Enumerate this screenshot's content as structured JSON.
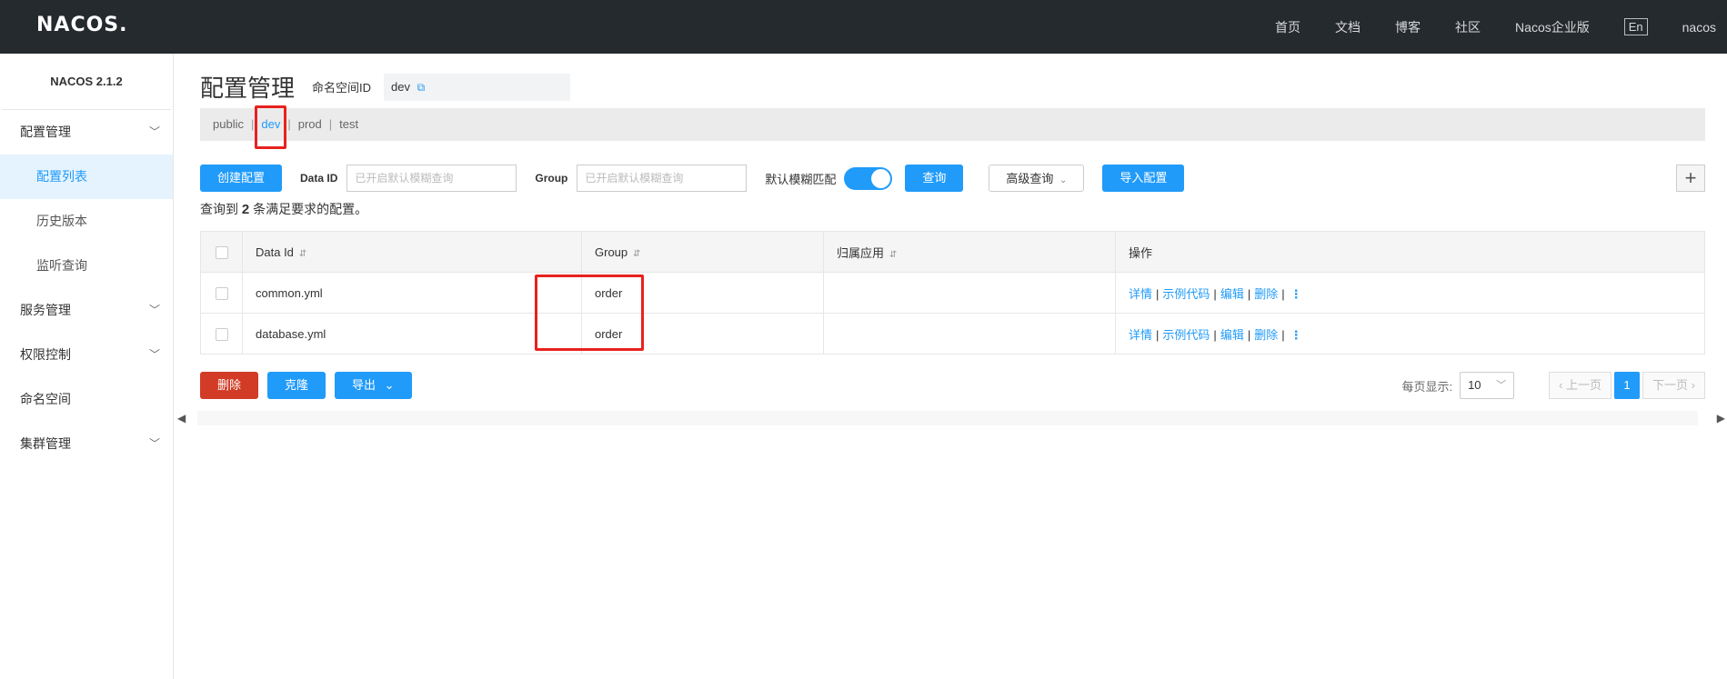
{
  "header": {
    "logo": "NACOS.",
    "nav": [
      "首页",
      "文档",
      "博客",
      "社区",
      "Nacos企业版"
    ],
    "lang": "En",
    "user": "nacos"
  },
  "sidebar": {
    "version": "NACOS 2.1.2",
    "groups": [
      {
        "label": "配置管理",
        "has_chevron": true
      },
      {
        "label": "服务管理",
        "has_chevron": true
      },
      {
        "label": "权限控制",
        "has_chevron": true
      },
      {
        "label": "命名空间",
        "has_chevron": false
      },
      {
        "label": "集群管理",
        "has_chevron": true
      }
    ],
    "config_items": [
      {
        "label": "配置列表",
        "active": true
      },
      {
        "label": "历史版本",
        "active": false
      },
      {
        "label": "监听查询",
        "active": false
      }
    ]
  },
  "main": {
    "title": "配置管理",
    "namespace_label": "命名空间ID",
    "namespace_value": "dev",
    "tabs": [
      "public",
      "dev",
      "prod",
      "test"
    ],
    "active_tab": "dev",
    "filters": {
      "create_button": "创建配置",
      "data_id_label": "Data ID",
      "data_id_placeholder": "已开启默认模糊查询",
      "group_label": "Group",
      "group_placeholder": "已开启默认模糊查询",
      "fuzzy_label": "默认模糊匹配",
      "fuzzy_on": true,
      "search_button": "查询",
      "advanced_button": "高级查询",
      "import_button": "导入配置",
      "plus": "+"
    },
    "result": {
      "prefix": "查询到",
      "count": "2",
      "suffix": "条满足要求的配置。"
    },
    "table": {
      "columns": [
        "Data Id",
        "Group",
        "归属应用",
        "操作"
      ],
      "sort_icon": "⇵",
      "rows": [
        {
          "data_id": "common.yml",
          "group": "order",
          "app": ""
        },
        {
          "data_id": "database.yml",
          "group": "order",
          "app": ""
        }
      ],
      "actions": [
        "详情",
        "示例代码",
        "编辑",
        "删除"
      ]
    },
    "footer": {
      "delete_button": "删除",
      "clone_button": "克隆",
      "export_button": "导出",
      "page_size_label": "每页显示:",
      "page_size": "10",
      "prev": "上一页",
      "page": "1",
      "next": "下一页"
    }
  },
  "colors": {
    "accent": "#209bfa",
    "danger": "#d23c26",
    "highlight": "#e8211d",
    "header_bg": "#252a2f"
  }
}
